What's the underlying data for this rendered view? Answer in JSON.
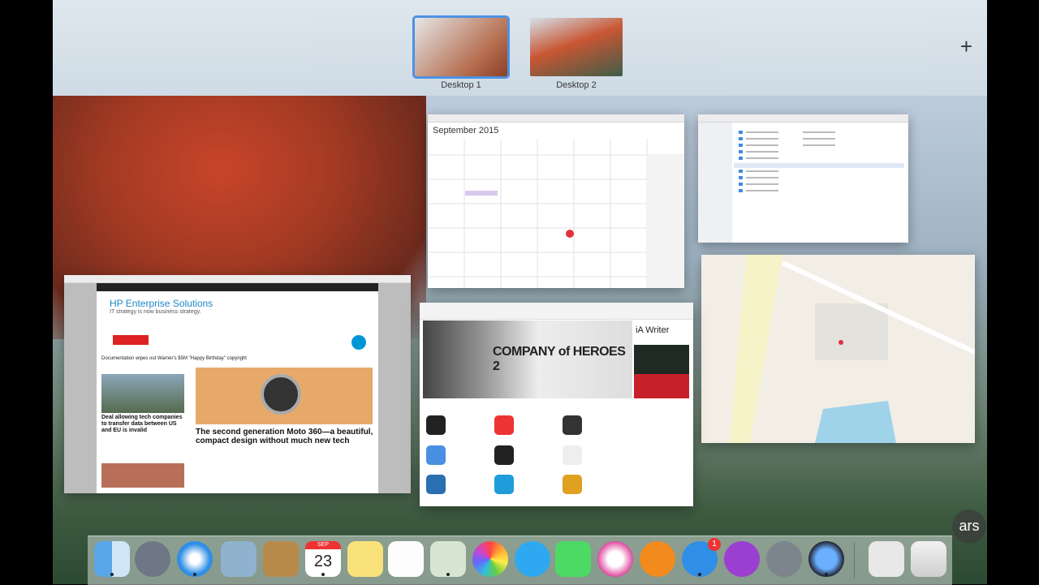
{
  "mission_control": {
    "spaces": [
      {
        "label": "Desktop 1"
      },
      {
        "label": "Desktop 2"
      }
    ],
    "add_symbol": "+"
  },
  "windows": {
    "calendar": {
      "month": "September 2015",
      "today": "23"
    },
    "safari": {
      "brand": "HP Enterprise Solutions",
      "tagline": "IT strategy is now business strategy.",
      "headline_small": "Documentation wipes out Warner's $5M \"Happy Birthday\" copyright",
      "side_story": "Deal allowing tech companies to transfer data between US and EU is invalid",
      "main_story": "The second generation Moto 360—a beautiful, compact design without much new tech"
    },
    "appstore": {
      "hero": "COMPANY of HEROES 2",
      "side_app": "iA Writer"
    }
  },
  "dock": {
    "calendar_day": "23",
    "calendar_month": "SEP",
    "appstore_badge": "1"
  },
  "watermark": "ars"
}
